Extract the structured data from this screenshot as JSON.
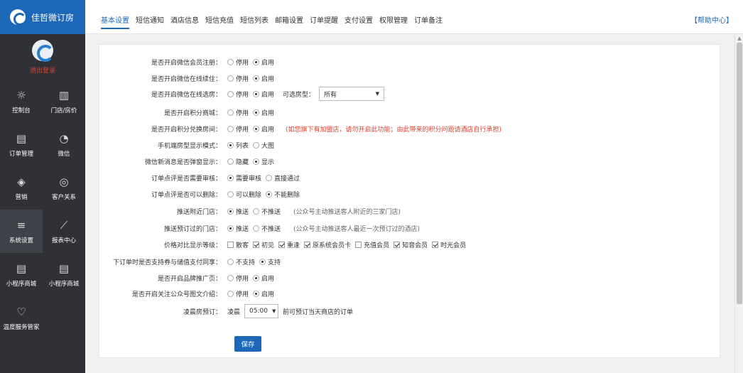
{
  "brand": {
    "title": "佳哲微订房"
  },
  "profile": {
    "logout": "退出登录"
  },
  "nav": [
    {
      "label": "控制台",
      "icon": "sun-icon"
    },
    {
      "label": "门店/房价",
      "icon": "building-icon"
    },
    {
      "label": "订单管理",
      "icon": "document-icon"
    },
    {
      "label": "微信",
      "icon": "wechat-icon"
    },
    {
      "label": "营销",
      "icon": "sale-tag-icon"
    },
    {
      "label": "客户关系",
      "icon": "glasses-icon"
    },
    {
      "label": "系统设置",
      "icon": "sliders-icon",
      "active": true
    },
    {
      "label": "报表中心",
      "icon": "line-chart-icon"
    },
    {
      "label": "小程序商城",
      "icon": "document-icon"
    },
    {
      "label": "小程序商城",
      "icon": "document-icon"
    },
    {
      "label": "温度服务管家",
      "icon": "hand-service-icon"
    }
  ],
  "tabs": [
    "基本设置",
    "短信通知",
    "酒店信息",
    "短信充值",
    "短信列表",
    "邮箱设置",
    "订单提醒",
    "支付设置",
    "权限管理",
    "订单备注"
  ],
  "help": "【帮助中心】",
  "form": {
    "rows": [
      {
        "label": "是否开启微信会员注册：",
        "options": [
          {
            "text": "停用"
          },
          {
            "text": "启用",
            "on": true
          }
        ]
      },
      {
        "label": "是否开启微信在线续住：",
        "options": [
          {
            "text": "停用"
          },
          {
            "text": "启用",
            "on": true
          }
        ]
      },
      {
        "label": "是否开启微信在线选房：",
        "options": [
          {
            "text": "停用"
          },
          {
            "text": "启用",
            "on": true
          }
        ],
        "select_label": "可选房型：",
        "select_value": "所有"
      },
      {
        "label": "是否开启积分商城：",
        "options": [
          {
            "text": "停用"
          },
          {
            "text": "启用",
            "on": true
          }
        ]
      },
      {
        "label": "是否开启积分兑换房间：",
        "options": [
          {
            "text": "停用"
          },
          {
            "text": "启用",
            "on": true
          }
        ],
        "warning": "(如您旗下有加盟店，请勿开启此功能；由此带来的积分问题请酒店自行承担)"
      },
      {
        "label": "手机端房型显示模式：",
        "options": [
          {
            "text": "列表",
            "on": true
          },
          {
            "text": "大图"
          }
        ]
      },
      {
        "label": "微信新消息是否弹窗显示：",
        "options": [
          {
            "text": "隐藏"
          },
          {
            "text": "显示",
            "on": true
          }
        ]
      },
      {
        "label": "订单点评是否需要审核：",
        "options": [
          {
            "text": "需要审核",
            "on": true
          },
          {
            "text": "直接通过"
          }
        ]
      },
      {
        "label": "订单点评是否可以删除：",
        "options": [
          {
            "text": "可以删除"
          },
          {
            "text": "不能删除",
            "on": true
          }
        ]
      },
      {
        "label": "推送附近门店：",
        "options": [
          {
            "text": "推送",
            "on": true
          },
          {
            "text": "不推送"
          }
        ],
        "note": "(公众号主动推送客人附近的三家门店)"
      },
      {
        "label": "推送预订过的门店：",
        "options": [
          {
            "text": "推送",
            "on": true
          },
          {
            "text": "不推送"
          }
        ],
        "note": "(公众号主动推送客人最近一次预订过的酒店)"
      },
      {
        "label": "价格对比显示等级：",
        "checks": [
          {
            "text": "散客"
          },
          {
            "text": "初见",
            "on": true
          },
          {
            "text": "重逢",
            "on": true
          },
          {
            "text": "原系统会员卡",
            "on": true
          },
          {
            "text": "充值会员"
          },
          {
            "text": "知音会员",
            "on": true
          },
          {
            "text": "时光会员",
            "on": true
          }
        ]
      },
      {
        "label": "下订单时是否支持券与储值支付同享：",
        "options": [
          {
            "text": "不支持"
          },
          {
            "text": "支持",
            "on": true
          }
        ]
      },
      {
        "label": "是否开启品牌推广页：",
        "options": [
          {
            "text": "停用"
          },
          {
            "text": "启用",
            "on": true
          }
        ]
      },
      {
        "label": "是否开启关注公众号图文介绍：",
        "options": [
          {
            "text": "停用"
          },
          {
            "text": "启用",
            "on": true
          }
        ]
      },
      {
        "label": "凌晨房预订：",
        "prefix": "凌晨",
        "time_value": "05:00",
        "suffix": "前可预订当天商店的订单"
      }
    ],
    "save": "保存"
  }
}
